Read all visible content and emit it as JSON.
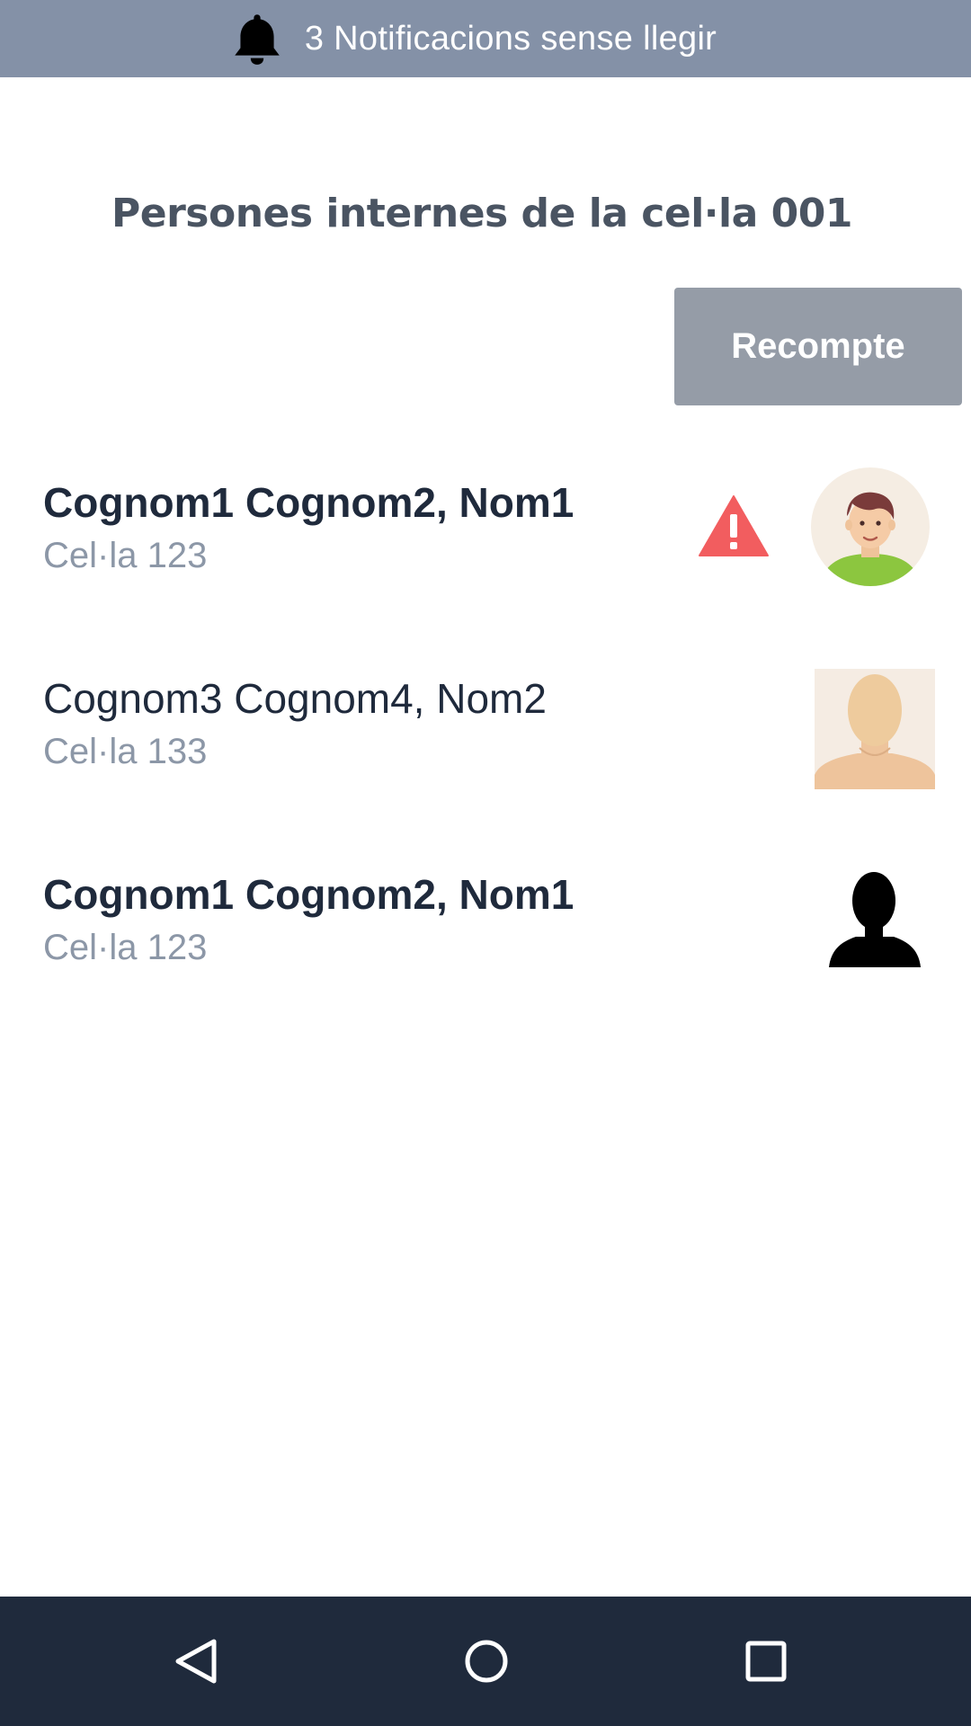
{
  "notifications": {
    "text": "3 Notificacions sense llegir",
    "icon": "bell-icon"
  },
  "page": {
    "title": "Persones internes de la cel·la 001"
  },
  "actions": {
    "recount_label": "Recompte"
  },
  "persons": [
    {
      "name": "Cognom1 Cognom2, Nom1",
      "cell": "Cel·la 123",
      "bold": true,
      "warning": true,
      "avatar": "cartoon-avatar"
    },
    {
      "name": "Cognom3 Cognom4, Nom2",
      "cell": "Cel·la 133",
      "bold": false,
      "warning": false,
      "avatar": "blank-face-avatar"
    },
    {
      "name": "Cognom1 Cognom2, Nom1",
      "cell": "Cel·la 123",
      "bold": true,
      "warning": false,
      "avatar": "silhouette-avatar"
    }
  ],
  "navigation": {
    "buttons": [
      "back-icon",
      "home-icon",
      "recents-icon"
    ]
  },
  "colors": {
    "notification_bar": "#8491a7",
    "button": "#959ca7",
    "warning": "#f25d5f",
    "text_primary": "#1f2a3c",
    "text_secondary": "#8c97a7",
    "nav_bar": "#1f2a3c"
  }
}
